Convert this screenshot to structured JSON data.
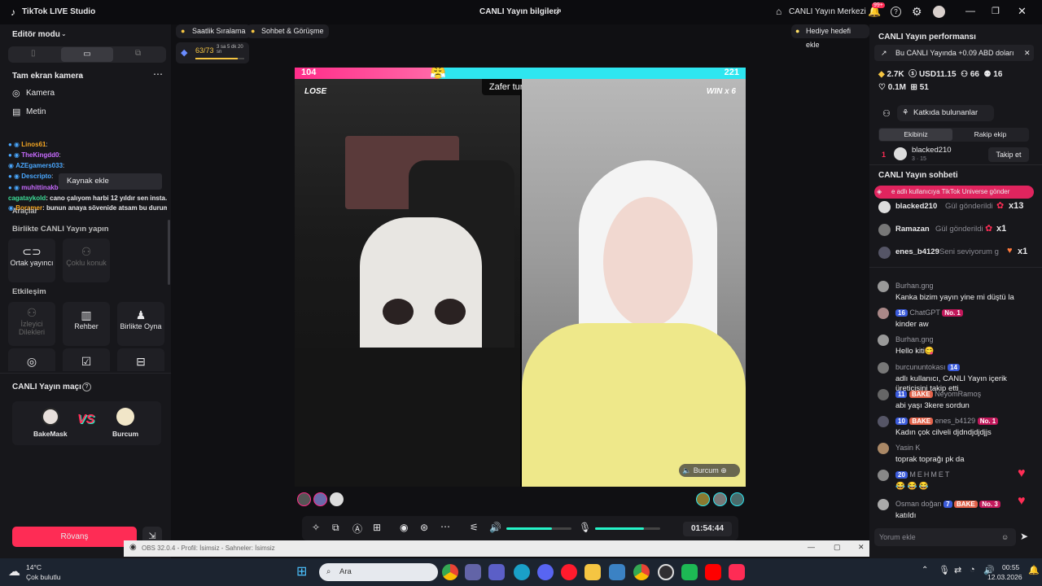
{
  "app": {
    "title": "TikTok LIVE Studio",
    "center_title": "CANLI Yayın bilgileri",
    "live_center": "CANLI Yayın Merkezi",
    "notif_count": "99+"
  },
  "left": {
    "editor_mode": "Editör modu",
    "camera_section": "Tam ekran kamera",
    "source_camera": "Kamera",
    "source_text": "Metin",
    "add_source_tooltip": "Kaynak ekle",
    "overlay_lines": [
      {
        "name": "Linos61",
        "name_color": "#f5a623",
        "text": ":"
      },
      {
        "name": "TheKingdd0",
        "name_color": "#c86bff",
        "text": ":"
      },
      {
        "name": "AZEgamers033",
        "name_color": "#4aa8ff",
        "text": ":"
      },
      {
        "name": "Descripto",
        "name_color": "#4aa8ff",
        "text": ":"
      },
      {
        "name": "muhittinakb",
        "name_color": "#c86bff",
        "text": ": KUPON DAN KWZANDİK ŞOV YAPTIK"
      },
      {
        "name": "cagataykold",
        "name_color": "#3ddc97",
        "text": ": cano çalıyom harbi 12 yıldır sen insta..."
      },
      {
        "name": "Boramer",
        "name_color": "#f5a623",
        "text": ": bunun anaya sövenide atsam bu durumu..."
      }
    ],
    "tools_label": "Araçlar",
    "collab_title": "Birlikte CANLI Yayın yapın",
    "collab_tiles": [
      {
        "label": "Ortak yayıncı",
        "icon": "link-icon",
        "enabled": true
      },
      {
        "label": "Çoklu konuk",
        "icon": "guests-icon",
        "enabled": false
      }
    ],
    "interaction_title": "Etkileşim",
    "interaction_tiles": [
      {
        "label": "İzleyici Dilekleri",
        "icon": "wish-icon",
        "enabled": false
      },
      {
        "label": "Rehber",
        "icon": "book-icon",
        "enabled": true
      },
      {
        "label": "Birlikte Oyna",
        "icon": "play-together-icon",
        "enabled": true
      }
    ],
    "match_title": "CANLI Yayın maçı",
    "match_players": [
      "BakeMask",
      "Burcum"
    ],
    "rematch_button": "Rövanş"
  },
  "center": {
    "tabs": [
      "Saatlik Sıralama",
      "Sohbet & Görüşme"
    ],
    "gift_goal": "Hediye hedefi ekle",
    "rank_progress": "63/73",
    "rank_timer": "3 sa 5 dk 20 sn",
    "score_left": "104",
    "score_right": "221",
    "round_label": "Zafer turu 02:02",
    "lose_label": "LOSE",
    "win_label": "WIN x 6",
    "guest_name": "Burcum",
    "timer": "01:54:44",
    "mic_level": 0.75,
    "volume_level": 0.7,
    "obs_title": "OBS 32.0.4 - Profil: İsimsiz - Sahneler: İsimsiz"
  },
  "right": {
    "perf_title": "CANLI Yayın performansı",
    "perf_note": "Bu CANLI Yayında +0.09 ABD doları",
    "stats": [
      {
        "icon": "diamond-icon",
        "value": "2.7K"
      },
      {
        "icon": "coin-icon",
        "value": "USD11.15"
      },
      {
        "icon": "viewers-icon",
        "value": "66"
      },
      {
        "icon": "followers-icon",
        "value": "16"
      }
    ],
    "stats2": [
      {
        "icon": "heart-icon",
        "value": "0.1M"
      },
      {
        "icon": "gift-icon",
        "value": "51"
      }
    ],
    "contributors_title": "Katkıda bulunanlar",
    "team_tabs": [
      "Ekibiniz",
      "Rakip ekip"
    ],
    "top_contributor": {
      "rank": "1",
      "name": "blacked210",
      "meta": "3 · 15",
      "button": "Takip et"
    },
    "chat_title": "CANLI Yayın sohbeti",
    "chat_banner": "e adlı kullanıcıya TikTok Universe gönder",
    "gifts": [
      {
        "name": "blacked210",
        "text": "Gül gönderildi",
        "count": "x13"
      },
      {
        "name": "Ramazan",
        "text": "Gül gönderildi",
        "count": "x1"
      },
      {
        "name": "enes_b4129",
        "text": "Seni seviyorum g",
        "count": "x1"
      }
    ],
    "messages": [
      {
        "name": "Burhan.gng",
        "text": "Kanka bizim yayın yine mi düştü la"
      },
      {
        "name": "ChatGPT",
        "badge": "16",
        "rank": "No. 1",
        "text": "kinder aw"
      },
      {
        "name": "Burhan.gng",
        "text": "Hello kiti😋"
      },
      {
        "name": "burcununtokası",
        "badge": "14",
        "text": "adlı kullanıcı, CANLI Yayın içerik üreticisini takip etti"
      },
      {
        "name": "NeyomRamoş",
        "badge": "11",
        "team": "BAKE",
        "text": "abi yaşı 3kere sordun"
      },
      {
        "name": "enes_b4129",
        "badge": "10",
        "team": "BAKE",
        "rank": "No. 1",
        "text": "Kadın çok cilveli djdndjdjdjjs"
      },
      {
        "name": "Yasin K",
        "text": "toprak toprağı pk da"
      },
      {
        "name": "MEHMET",
        "badge": "20",
        "text": "😂 😂 😂"
      },
      {
        "name": "Osman doğan",
        "badge": "7",
        "team": "BAKE",
        "rank": "No. 3",
        "text": "katıldı"
      }
    ],
    "comment_placeholder": "Yorum ekle"
  },
  "taskbar": {
    "weather_temp": "14°C",
    "weather_desc": "Çok bulutlu",
    "search_placeholder": "Ara",
    "time": "00:55",
    "date": "12.03.2026"
  },
  "colors": {
    "accent": "#fe2c55",
    "score_left": "#ff2d8a",
    "score_right": "#2ee6f0",
    "teal": "#25f4c8"
  }
}
